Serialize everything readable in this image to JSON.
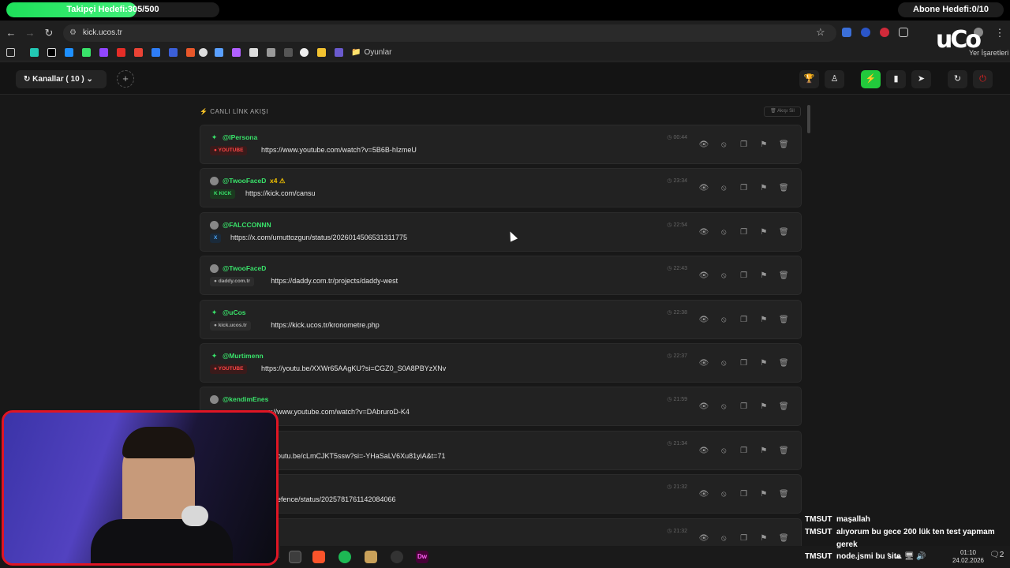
{
  "overlay": {
    "follower_goal": {
      "label": "Takipçi Hedefi:305/500",
      "current": 305,
      "target": 500
    },
    "subscriber_goal": {
      "label": "Abone Hedefi:0/10"
    }
  },
  "browser": {
    "url": "kick.ucos.tr",
    "bookmark_folder": "Oyunlar",
    "bookmarks_right": "Yer İşaretleri"
  },
  "app": {
    "channels_label": "Kanallar ( 10 )",
    "add_label": "+",
    "section_title": "CANLI LİNK AKIŞI",
    "clear_label": "Akışı Sil",
    "colors": {
      "accent": "#39e26a",
      "active_button": "#22c93c",
      "danger": "#e02020"
    },
    "links": [
      {
        "user": "@IPersona",
        "badge": "YOUTUBE",
        "badge_type": "youtube",
        "url": "https://www.youtube.com/watch?v=5B6B-hIzmeU",
        "time": "00:44",
        "user_icon": "kick-icon",
        "extra": ""
      },
      {
        "user": "@TwooFaceD",
        "badge": "KICK",
        "badge_type": "kick",
        "url": "https://kick.com/cansu",
        "time": "23:34",
        "user_icon": "avatar",
        "extra": "x4 ⚠"
      },
      {
        "user": "@FALCCONNN",
        "badge": "X",
        "badge_type": "x",
        "url": "https://x.com/umuttozgun/status/2026014506531311775",
        "time": "22:54",
        "user_icon": "avatar",
        "extra": ""
      },
      {
        "user": "@TwooFaceD",
        "badge": "daddy.com.tr",
        "badge_type": "site",
        "url": "https://daddy.com.tr/projects/daddy-west",
        "time": "22:43",
        "user_icon": "avatar",
        "extra": ""
      },
      {
        "user": "@uCos",
        "badge": "kick.ucos.tr",
        "badge_type": "site",
        "url": "https://kick.ucos.tr/kronometre.php",
        "time": "22:38",
        "user_icon": "kick-icon",
        "extra": ""
      },
      {
        "user": "@Murtimenn",
        "badge": "YOUTUBE",
        "badge_type": "youtube",
        "url": "https://youtu.be/XXWr65AAgKU?si=CGZ0_S0A8PBYzXNv",
        "time": "22:37",
        "user_icon": "kick-icon",
        "extra": ""
      },
      {
        "user": "@kendimEnes",
        "badge": "",
        "badge_type": "hidden",
        "url": "s://www.youtube.com/watch?v=DAbruroD-K4",
        "time": "21:59",
        "user_icon": "avatar",
        "extra": ""
      },
      {
        "user": "",
        "badge": "",
        "badge_type": "hidden",
        "url": "://youtu.be/cLmCJKT5ssw?si=-YHaSaLV6Xu81yiA&t=71",
        "time": "21:34",
        "user_icon": "",
        "extra": ""
      },
      {
        "user": "",
        "badge": "",
        "badge_type": "hidden",
        "url": "tcdefence/status/2025781761142084066",
        "time": "21:32",
        "user_icon": "",
        "extra": ""
      },
      {
        "user": "",
        "badge": "",
        "badge_type": "hidden",
        "url": "",
        "time": "21:32",
        "user_icon": "",
        "extra": ""
      }
    ]
  },
  "chat": [
    {
      "user": "TMSUT",
      "message": "maşallah"
    },
    {
      "user": "TMSUT",
      "message": "alıyorum bu gece 200 lük ten test yapmam"
    },
    {
      "user": "",
      "message": "gerek"
    },
    {
      "user": "TMSUT",
      "message": "node.jsmi bu site"
    }
  ],
  "taskbar": {
    "clock_time": "01:10",
    "clock_date": "24.02.2026",
    "notification_count": "2"
  }
}
